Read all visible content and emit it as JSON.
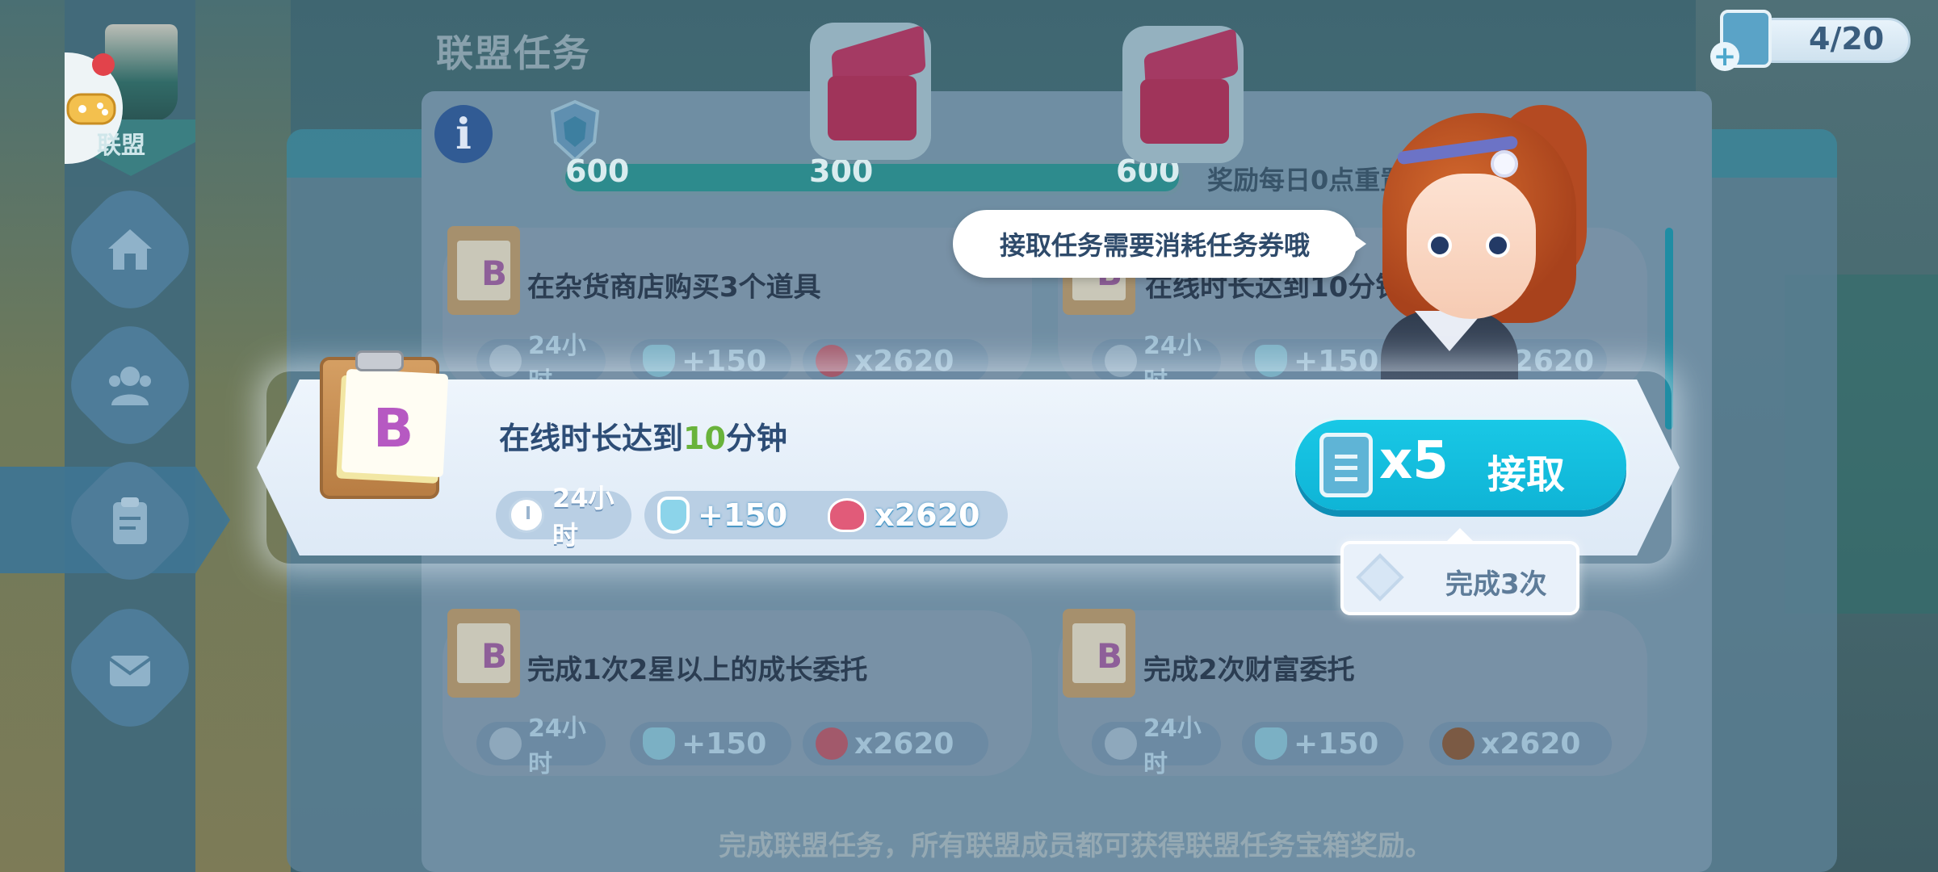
{
  "panel": {
    "title": "联盟任务",
    "reset_note": "奖励每日0点重置",
    "footer_note": "完成联盟任务，所有联盟成员都可获得联盟任务宝箱奖励。"
  },
  "sidebar": {
    "alliance_label": "联盟",
    "items": [
      {
        "name": "home",
        "icon": "home-icon"
      },
      {
        "name": "members",
        "icon": "members-icon"
      },
      {
        "name": "tasks",
        "icon": "clipboard-icon",
        "selected": true
      },
      {
        "name": "mail",
        "icon": "envelope-icon"
      }
    ]
  },
  "tickets": {
    "count": "4/20"
  },
  "progress": {
    "labels": [
      "600",
      "300",
      "600"
    ]
  },
  "guide": {
    "speech": "接取任务需要消耗任务券哦"
  },
  "tasks": [
    {
      "grade": "B",
      "title": "在杂货商店购买3个道具",
      "time": "24小时",
      "points": "+150",
      "reward": "x2620"
    },
    {
      "grade": "B",
      "title": "在线时长达到10分钟",
      "time": "24小时",
      "points": "+150",
      "reward": "2620"
    },
    {
      "grade": "B",
      "title": "完成1次2星以上的成长委托",
      "time": "24小时",
      "points": "+150",
      "reward": "x2620"
    },
    {
      "grade": "B",
      "title": "完成2次财富委托",
      "time": "24小时",
      "points": "+150",
      "reward": "x2620"
    }
  ],
  "highlight_task": {
    "grade": "B",
    "title_prefix": "在线时长达到",
    "title_number": "10",
    "title_suffix": "分钟",
    "time": "24小时",
    "points": "+150",
    "reward": "x2620",
    "cost": "x5",
    "accept_label": "接取",
    "completion": "完成3次"
  },
  "colors": {
    "accept_button": "#0fb4d6",
    "highlight_number": "#69b33b",
    "grade_letter": "#b659c2"
  }
}
